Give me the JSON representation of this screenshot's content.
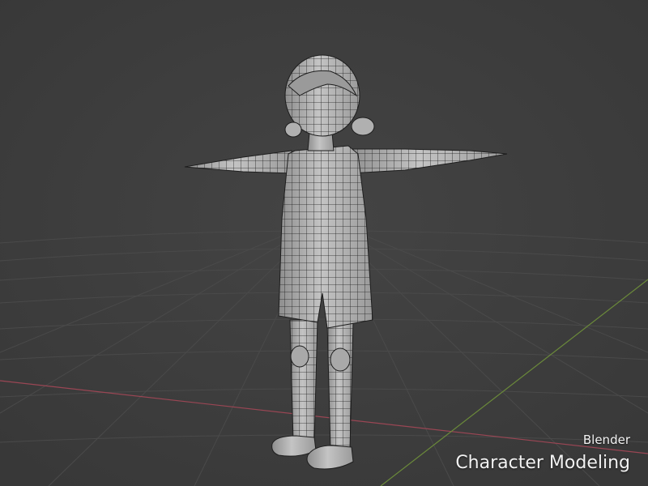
{
  "viewport": {
    "background_color": "#3d3d3d",
    "grid_color": "#4a4a4a",
    "x_axis_color": "#9a4654",
    "y_axis_color": "#6b8a3a",
    "model_color": "#b9b9b9",
    "wire_color": "#1e1e1e"
  },
  "caption": {
    "app_name": "Blender",
    "title": "Character Modeling"
  }
}
